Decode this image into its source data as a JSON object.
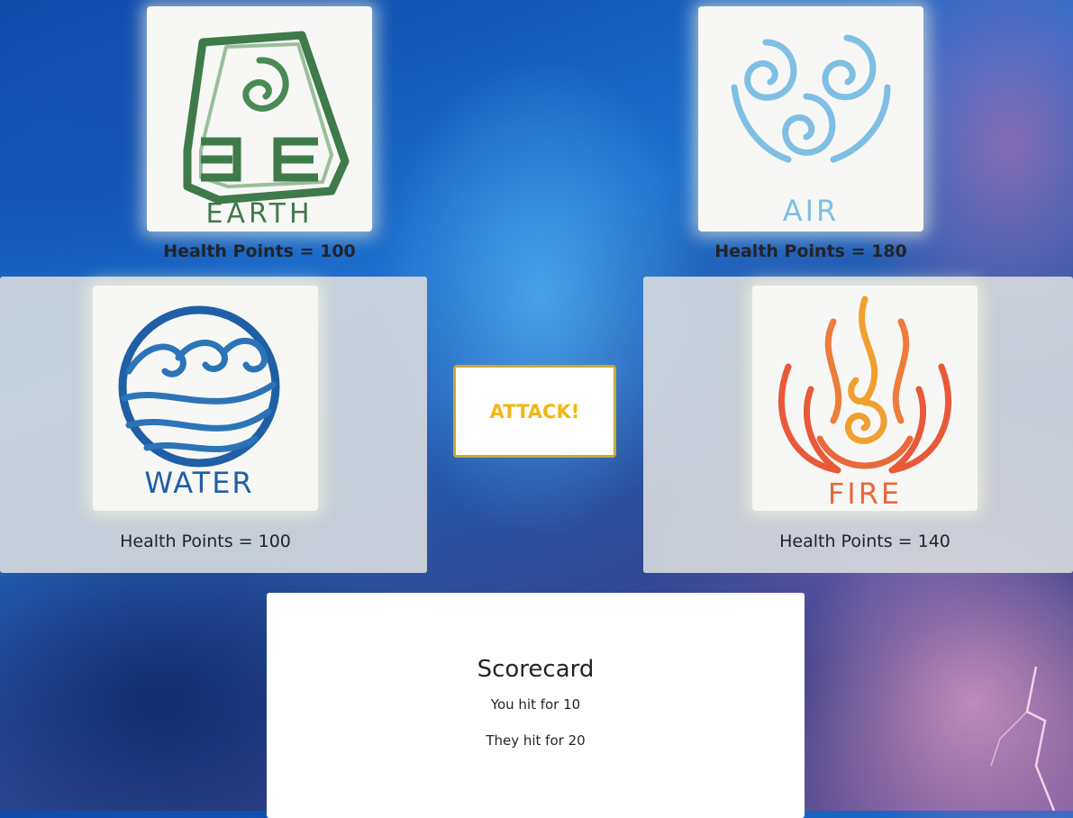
{
  "cards": {
    "earth": {
      "icon": "earth-emblem-icon",
      "label": "EARTH",
      "hp_label": "Health Points = 100",
      "color": "#3e7a4a"
    },
    "air": {
      "icon": "air-emblem-icon",
      "label": "AIR",
      "hp_label": "Health Points = 180",
      "color": "#7fbfe3"
    },
    "water": {
      "icon": "water-emblem-icon",
      "label": "WATER",
      "hp_label": "Health Points = 100",
      "color": "#1f5fa6"
    },
    "fire": {
      "icon": "fire-emblem-icon",
      "label": "FIRE",
      "hp_label": "Health Points = 140",
      "color": "#e8693a"
    }
  },
  "attack_button": {
    "label": "ATTACK!",
    "text_color": "#f2b613",
    "border_color": "#c9a931"
  },
  "scorecard": {
    "title": "Scorecard",
    "you_hit": "You hit for 10",
    "they_hit": "They hit for 20"
  }
}
